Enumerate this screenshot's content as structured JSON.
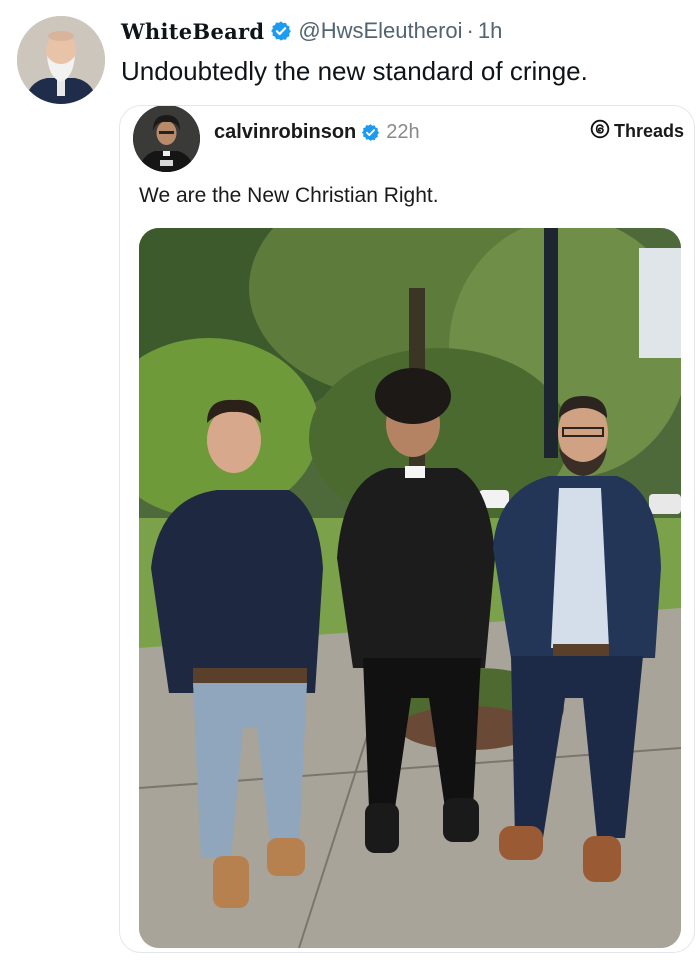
{
  "tweet": {
    "display_name": "WhiteBeard",
    "handle": "@HwsEleutheroi",
    "separator": "·",
    "time": "1h",
    "text": "Undoubtedly the new standard of cringe.",
    "avatar_icon": "user-avatar"
  },
  "quoted_post": {
    "username": "calvinrobinson",
    "time": "22h",
    "platform_label": "Threads",
    "platform_icon": "threads-logo",
    "text": "We are the New Christian Right.",
    "avatar_icon": "user-avatar"
  },
  "colors": {
    "verified_blue": "#1d9bf0",
    "secondary_text": "#536471"
  }
}
